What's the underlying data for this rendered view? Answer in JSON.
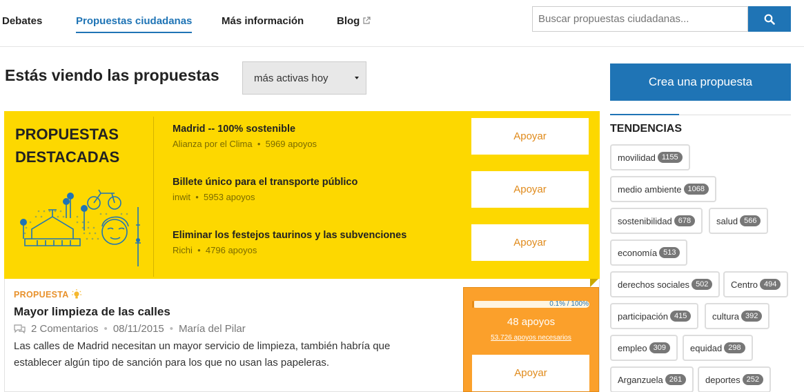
{
  "nav": {
    "items": [
      {
        "label": "Debates"
      },
      {
        "label": "Propuestas ciudadanas"
      },
      {
        "label": "Más información"
      },
      {
        "label": "Blog"
      }
    ],
    "search_placeholder": "Buscar propuestas ciudadanas..."
  },
  "header": {
    "title": "Estás viendo las propuestas",
    "order_selected": "más activas hoy"
  },
  "featured": {
    "title": "PROPUESTAS DESTACADAS",
    "items": [
      {
        "title": "Madrid -- 100% sostenible",
        "author": "Alianza por el Clima",
        "supports": "5969 apoyos",
        "button": "Apoyar"
      },
      {
        "title": "Billete único para el transporte público",
        "author": "inwit",
        "supports": "5953 apoyos",
        "button": "Apoyar"
      },
      {
        "title": "Eliminar los festejos taurinos y las subvenciones",
        "author": "Richi",
        "supports": "4796 apoyos",
        "button": "Apoyar"
      }
    ]
  },
  "proposal": {
    "tag": "PROPUESTA",
    "title": "Mayor limpieza de las calles",
    "comments": "2 Comentarios",
    "date": "08/11/2015",
    "author": "María del Pilar",
    "description": "Las calles de Madrid necesitan un mayor servicio de limpieza, también habría que establecer algún tipo de sanción para los que no usan las papeleras.",
    "progress_label": "0.1% / 100%",
    "progress_fraction": 0.001,
    "supports": "48 apoyos",
    "needed": "53.726 apoyos necesarios",
    "button": "Apoyar"
  },
  "sidebar": {
    "create_button": "Crea una propuesta",
    "trends_title": "TENDENCIAS",
    "tags": [
      {
        "name": "movilidad",
        "count": "1155"
      },
      {
        "name": "medio ambiente",
        "count": "1068"
      },
      {
        "name": "sostenibilidad",
        "count": "678"
      },
      {
        "name": "salud",
        "count": "566"
      },
      {
        "name": "economía",
        "count": "513"
      },
      {
        "name": "derechos sociales",
        "count": "502"
      },
      {
        "name": "Centro",
        "count": "494"
      },
      {
        "name": "participación",
        "count": "415"
      },
      {
        "name": "cultura",
        "count": "392"
      },
      {
        "name": "empleo",
        "count": "309"
      },
      {
        "name": "equidad",
        "count": "298"
      },
      {
        "name": "Arganzuela",
        "count": "261"
      },
      {
        "name": "deportes",
        "count": "252"
      }
    ]
  },
  "colors": {
    "brand_blue": "#1f74b5",
    "featured_yellow": "#fdd800",
    "support_orange": "#fba02b"
  }
}
